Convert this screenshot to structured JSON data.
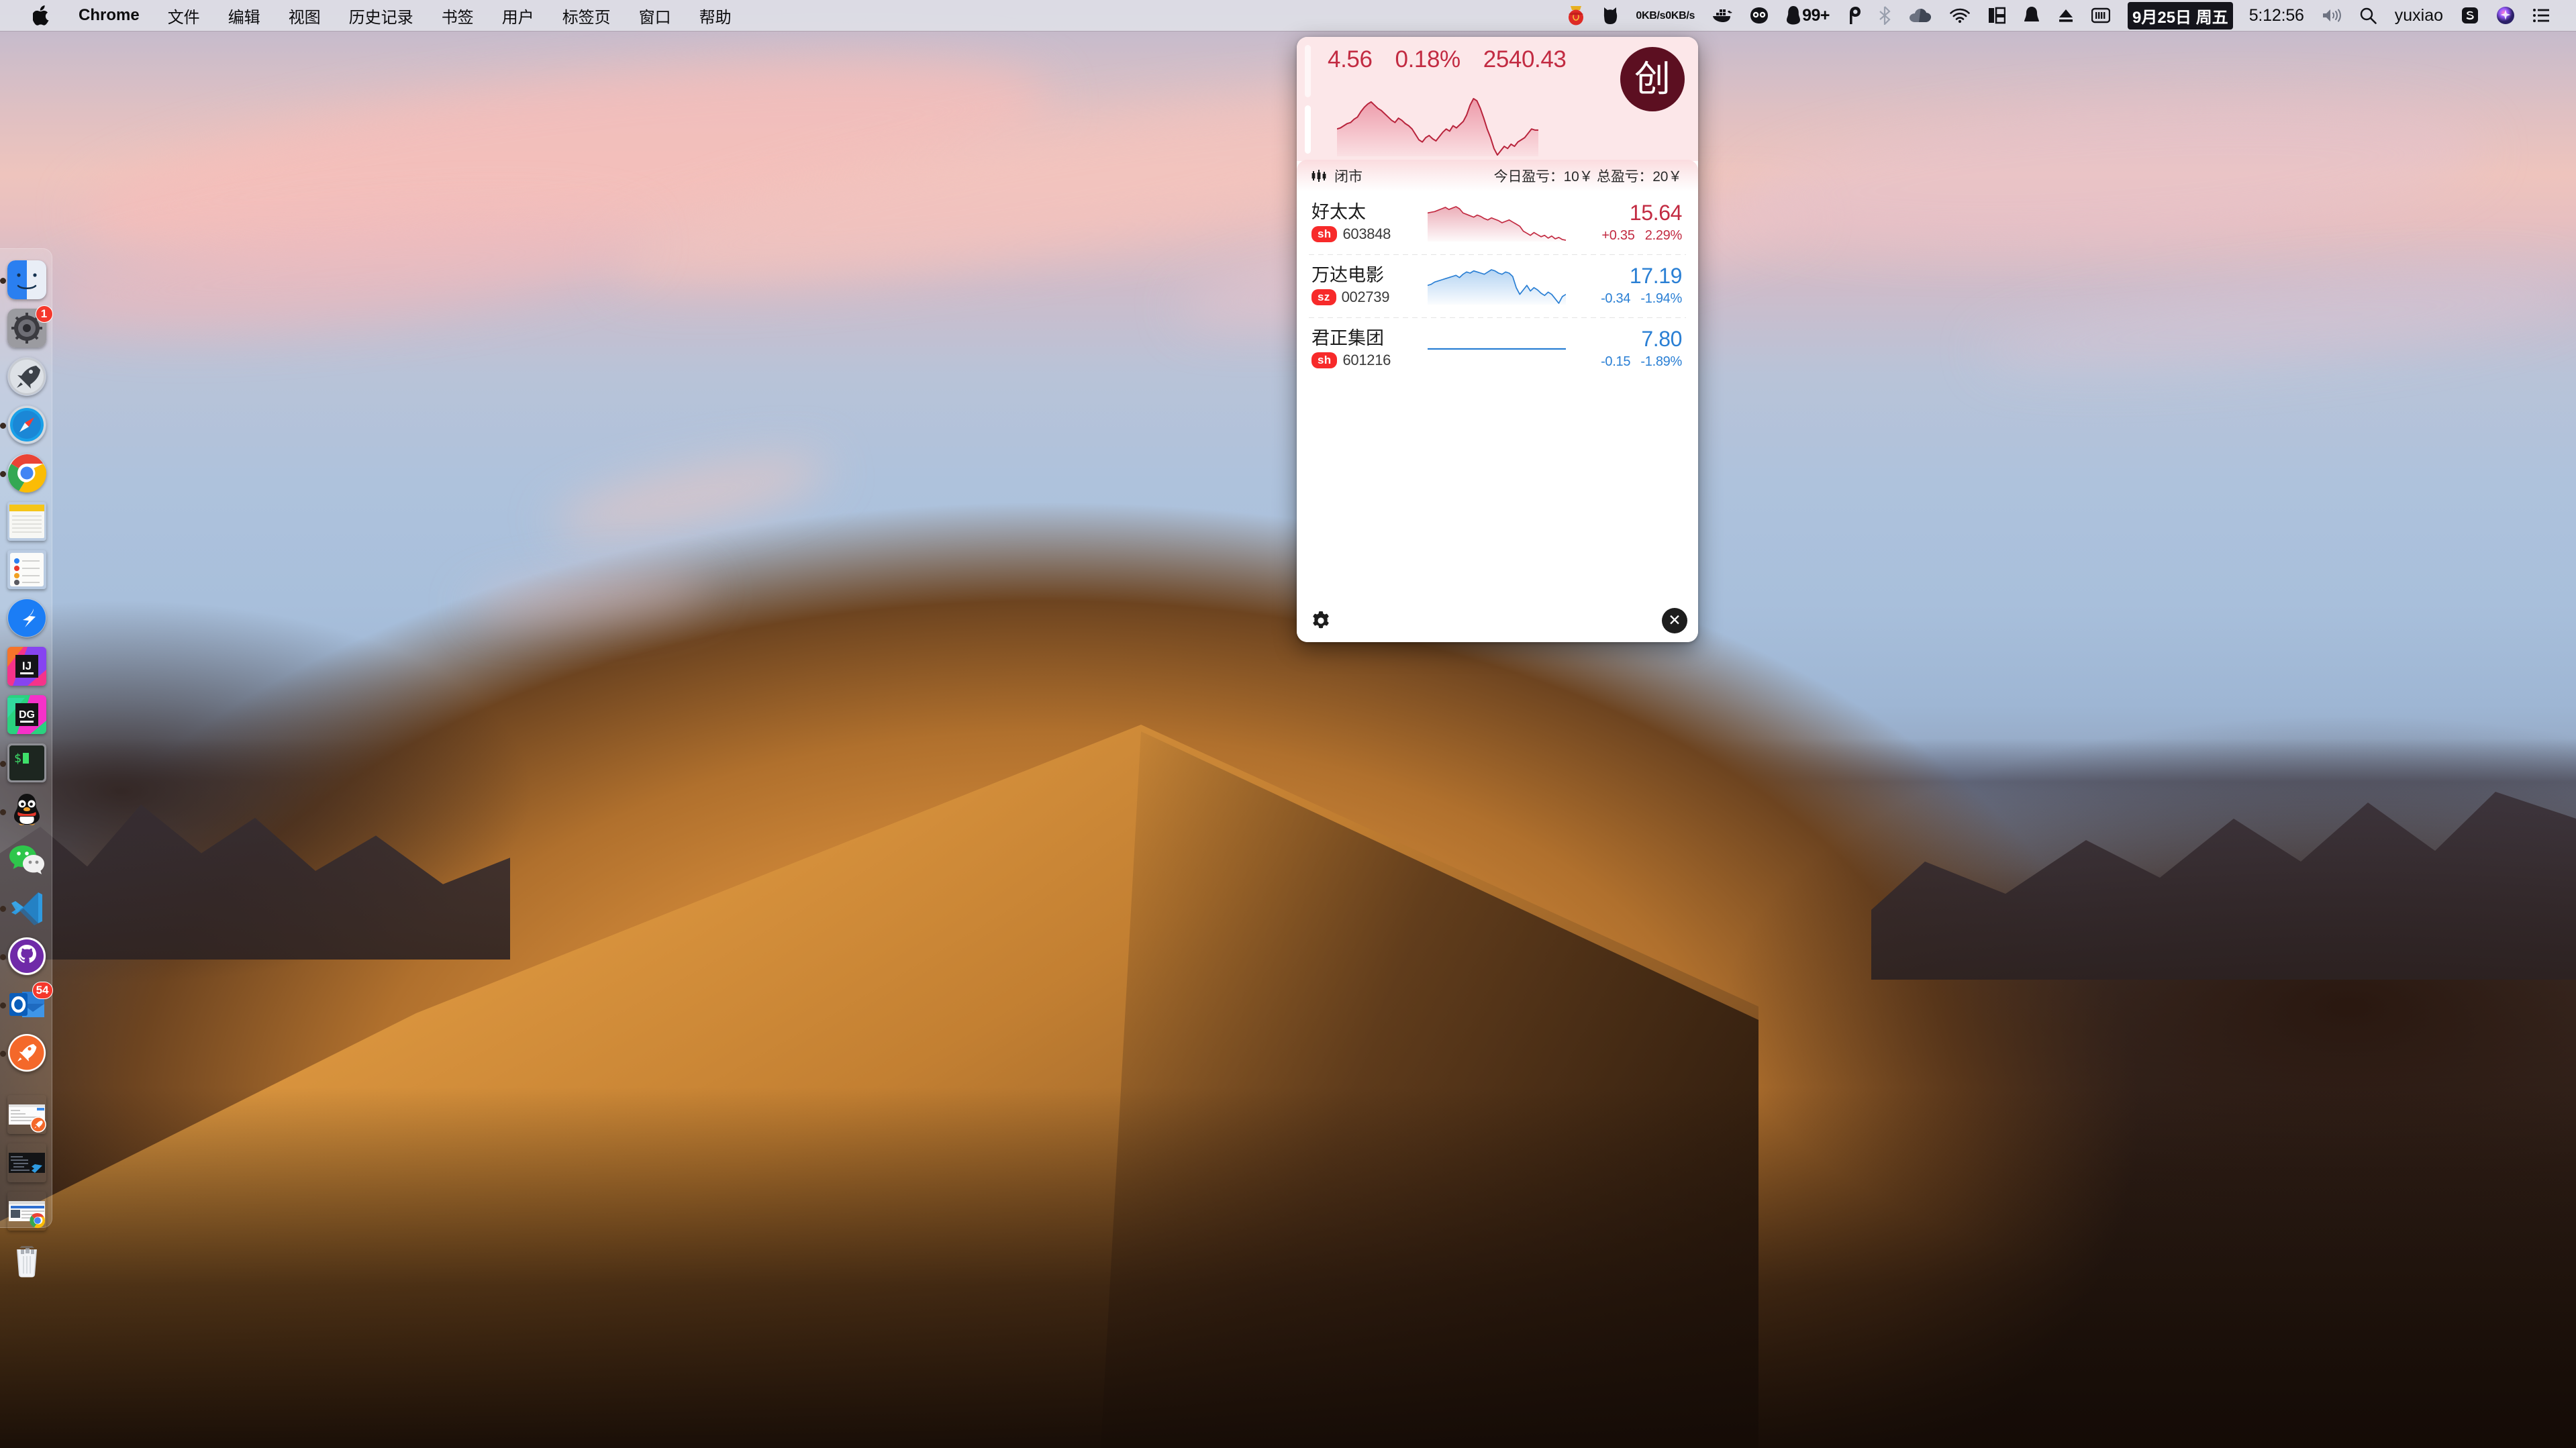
{
  "menubar": {
    "apple_icon": "apple-logo-icon",
    "app_name": "Chrome",
    "items": [
      "文件",
      "编辑",
      "视图",
      "历史记录",
      "书签",
      "用户",
      "标签页",
      "窗口",
      "帮助"
    ],
    "status": {
      "net_up": "0KB/s",
      "net_down": "0KB/s",
      "notif_badge": "99+",
      "date": "9月25日 周五",
      "time": "5:12:56",
      "username": "yuxiao",
      "icons": [
        "red-packet-icon",
        "black-cat-icon",
        "network-speed-icon",
        "docker-whale-icon",
        "owl-icon",
        "penguin-qq-icon",
        "baidu-netdisk-icon",
        "bluetooth-icon",
        "onedrive-cloud-icon",
        "wifi-icon",
        "window-layout-icon",
        "bell-icon",
        "eject-icon",
        "keyboard-input-icon",
        "volume-icon",
        "search-icon",
        "sogou-input-icon",
        "siri-icon",
        "control-center-icon"
      ]
    }
  },
  "dock": {
    "items": [
      {
        "name": "finder",
        "icon": "finder-icon",
        "running": true,
        "badge": ""
      },
      {
        "name": "system-preferences",
        "icon": "gear-icon",
        "running": false,
        "badge": "1"
      },
      {
        "name": "launchpad",
        "icon": "rocket-icon",
        "running": false,
        "badge": ""
      },
      {
        "name": "safari",
        "icon": "compass-icon",
        "running": true,
        "badge": ""
      },
      {
        "name": "chrome",
        "icon": "chrome-icon",
        "running": true,
        "badge": ""
      },
      {
        "name": "notes",
        "icon": "notepad-icon",
        "running": false,
        "badge": ""
      },
      {
        "name": "reminders",
        "icon": "checklist-icon",
        "running": false,
        "badge": ""
      },
      {
        "name": "dingtalk",
        "icon": "dingtalk-wing-icon",
        "running": false,
        "badge": ""
      },
      {
        "name": "intellij-idea",
        "icon": "ij-icon",
        "running": false,
        "badge": ""
      },
      {
        "name": "datagrip",
        "icon": "dg-icon",
        "running": false,
        "badge": ""
      },
      {
        "name": "terminal",
        "icon": "terminal-icon",
        "running": true,
        "badge": ""
      },
      {
        "name": "qq",
        "icon": "penguin-icon",
        "running": true,
        "badge": ""
      },
      {
        "name": "wechat",
        "icon": "wechat-icon",
        "running": false,
        "badge": ""
      },
      {
        "name": "vscode",
        "icon": "vscode-icon",
        "running": true,
        "badge": ""
      },
      {
        "name": "github-desktop",
        "icon": "github-cat-icon",
        "running": true,
        "badge": ""
      },
      {
        "name": "outlook",
        "icon": "outlook-o-icon",
        "running": true,
        "badge": "54"
      },
      {
        "name": "postman",
        "icon": "postman-rocket-icon",
        "running": true,
        "badge": ""
      }
    ],
    "minimized": [
      {
        "name": "postman-window",
        "icon": "window-postman-icon"
      },
      {
        "name": "vscode-window",
        "icon": "window-vscode-icon"
      },
      {
        "name": "chrome-window",
        "icon": "window-chrome-icon"
      }
    ],
    "trash": {
      "name": "trash",
      "icon": "trash-icon"
    }
  },
  "widget": {
    "index": {
      "change": "4.56",
      "change_percent": "0.18%",
      "value": "2540.43",
      "badge_label": "创",
      "badge_color": "#5c0f21",
      "accent_up": "#c22b42",
      "bg": "#fce7e9"
    },
    "status": {
      "market_icon": "candlestick-icon",
      "market_state": "闭市",
      "pnl": "今日盈亏：10￥ 总盈亏：20￥"
    },
    "stocks": [
      {
        "name": "好太太",
        "market": "sh",
        "code": "603848",
        "price": "15.64",
        "change": "+0.35",
        "change_percent": "2.29%",
        "direction": "up",
        "color": "#c22b42"
      },
      {
        "name": "万达电影",
        "market": "sz",
        "code": "002739",
        "price": "17.19",
        "change": "-0.34",
        "change_percent": "-1.94%",
        "direction": "down",
        "color": "#2a7fd4"
      },
      {
        "name": "君正集团",
        "market": "sh",
        "code": "601216",
        "price": "7.80",
        "change": "-0.15",
        "change_percent": "-1.89%",
        "direction": "down",
        "color": "#2a7fd4"
      }
    ],
    "footer": {
      "settings_icon": "gear-icon",
      "close_icon": "close-icon",
      "close_label": "✕"
    }
  },
  "chart_data": [
    {
      "type": "line",
      "title": "创业板指 intraday",
      "name": "index-sparkline",
      "color": "#c22b42",
      "filled": true,
      "x": [
        0,
        1,
        2,
        3,
        4,
        5,
        6,
        7,
        8,
        9,
        10,
        11,
        12,
        13,
        14,
        15,
        16,
        17,
        18,
        19,
        20,
        21,
        22,
        23,
        24,
        25,
        26,
        27,
        28,
        29,
        30,
        31,
        32,
        33,
        34,
        35,
        36,
        37,
        38,
        39,
        40,
        41,
        42,
        43,
        44,
        45,
        46,
        47,
        48,
        49,
        50,
        51,
        52,
        53,
        54,
        55,
        56,
        57,
        58,
        59
      ],
      "values": [
        30,
        31,
        33,
        35,
        36,
        39,
        41,
        46,
        50,
        53,
        55,
        52,
        49,
        47,
        44,
        41,
        38,
        36,
        40,
        38,
        35,
        33,
        30,
        25,
        20,
        18,
        22,
        24,
        21,
        19,
        23,
        27,
        30,
        28,
        33,
        31,
        34,
        37,
        43,
        52,
        58,
        56,
        49,
        40,
        30,
        22,
        12,
        6,
        10,
        14,
        12,
        16,
        14,
        18,
        20,
        22,
        26,
        30,
        29,
        29
      ],
      "ylabel": "",
      "xlabel": "",
      "grid": false
    },
    {
      "type": "line",
      "title": "好太太 603848 intraday",
      "name": "stock-sparkline-603848",
      "color": "#c22b42",
      "filled": true,
      "x": [
        0,
        1,
        2,
        3,
        4,
        5,
        6,
        7,
        8,
        9,
        10,
        11,
        12,
        13,
        14,
        15,
        16,
        17,
        18,
        19,
        20,
        21,
        22,
        23,
        24,
        25,
        26,
        27,
        28,
        29,
        30,
        31,
        32,
        33,
        34,
        35,
        36,
        37,
        38,
        39
      ],
      "values": [
        44,
        45,
        46,
        48,
        50,
        52,
        49,
        51,
        53,
        50,
        44,
        42,
        40,
        38,
        41,
        39,
        36,
        34,
        37,
        35,
        33,
        30,
        32,
        34,
        31,
        28,
        25,
        18,
        15,
        12,
        16,
        13,
        10,
        12,
        8,
        11,
        7,
        9,
        6,
        5
      ],
      "ylabel": "",
      "xlabel": "",
      "grid": false
    },
    {
      "type": "line",
      "title": "万达电影 002739 intraday",
      "name": "stock-sparkline-002739",
      "color": "#2a7fd4",
      "filled": true,
      "x": [
        0,
        1,
        2,
        3,
        4,
        5,
        6,
        7,
        8,
        9,
        10,
        11,
        12,
        13,
        14,
        15,
        16,
        17,
        18,
        19,
        20,
        21,
        22,
        23,
        24,
        25,
        26,
        27,
        28,
        29,
        30,
        31,
        32,
        33,
        34,
        35,
        36,
        37,
        38,
        39
      ],
      "values": [
        22,
        23,
        25,
        26,
        27,
        28,
        29,
        30,
        31,
        29,
        32,
        34,
        33,
        35,
        34,
        33,
        32,
        34,
        36,
        35,
        33,
        32,
        34,
        33,
        30,
        20,
        14,
        18,
        22,
        17,
        20,
        18,
        15,
        13,
        16,
        14,
        10,
        6,
        12,
        14
      ],
      "ylabel": "",
      "xlabel": "",
      "grid": false
    },
    {
      "type": "line",
      "title": "君正集团 601216 intraday",
      "name": "stock-sparkline-601216",
      "color": "#2a7fd4",
      "filled": false,
      "x": [
        0,
        1
      ],
      "values": [
        28,
        28
      ],
      "ylabel": "",
      "xlabel": "",
      "grid": false
    }
  ]
}
